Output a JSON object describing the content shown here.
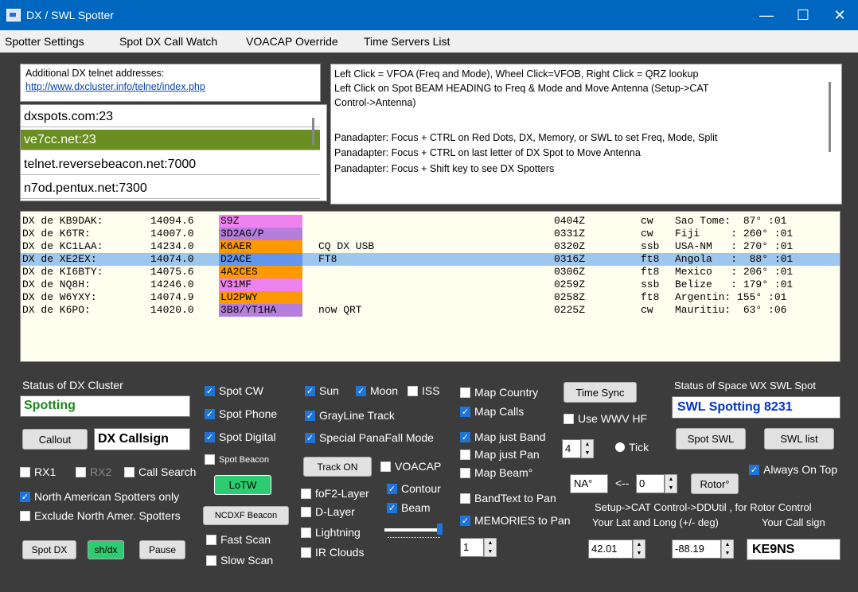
{
  "window": {
    "title": "DX / SWL Spotter"
  },
  "menu": {
    "items": [
      "Spotter Settings",
      "Spot DX Call Watch",
      "VOACAP Override",
      "Time Servers List"
    ]
  },
  "telnet": {
    "header": "Additional DX telnet addresses:",
    "link": "http://www.dxcluster.info/telnet/index.php",
    "items": [
      "dxspots.com:23",
      "ve7cc.net:23",
      "telnet.reversebeacon.net:7000",
      "n7od.pentux.net:7300"
    ],
    "selected_index": 1
  },
  "info": {
    "lines": [
      "Left Click = VFOA (Freq and Mode), Wheel Click=VFOB, Right Click = QRZ lookup",
      "Left Click on Spot BEAM HEADING to Freq & Mode and Move Antenna (Setup->CAT",
      "Control->Antenna)",
      "",
      "Panadapter: Focus + CTRL on Red Dots, DX, Memory, or SWL to set Freq, Mode, Split",
      "Panadapter: Focus + CTRL on last letter of DX Spot to Move Antenna",
      "Panadapter:  Focus + Shift key to see DX Spotters"
    ]
  },
  "spots": [
    {
      "spotter": "DX de KB9DAK:",
      "freq": "14094.6",
      "call": "S9Z",
      "call_color": "#ee82ee",
      "comment": "",
      "time": "0404Z",
      "mode": "cw",
      "country": "Sao Tome:  87° :01"
    },
    {
      "spotter": "DX de K6TR:",
      "freq": "14007.0",
      "call": "3D2AG/P",
      "call_color": "#b57edc",
      "comment": "",
      "time": "0331Z",
      "mode": "cw",
      "country": "Fiji     : 260° :01"
    },
    {
      "spotter": "DX de KC1LAA:",
      "freq": "14234.0",
      "call": "K6AER",
      "call_color": "#ff9900",
      "comment": "CQ DX USB",
      "time": "0320Z",
      "mode": "ssb",
      "country": "USA-NM   : 270° :01"
    },
    {
      "spotter": "DX de XE2EX:",
      "freq": "14074.0",
      "call": "D2ACE",
      "call_color": "#6495ed",
      "comment": "FT8",
      "time": "0316Z",
      "mode": "ft8",
      "country": "Angola   :  88° :01"
    },
    {
      "spotter": "DX de KI6BTY:",
      "freq": "14075.6",
      "call": "4A2CES",
      "call_color": "#ff9900",
      "comment": "",
      "time": "0306Z",
      "mode": "ft8",
      "country": "Mexico   : 206° :01"
    },
    {
      "spotter": "DX de NQ8H:",
      "freq": "14246.0",
      "call": "V31MF",
      "call_color": "#ee82ee",
      "comment": "",
      "time": "0259Z",
      "mode": "ssb",
      "country": "Belize   : 179° :01"
    },
    {
      "spotter": "DX de W6YXY:",
      "freq": "14074.9",
      "call": "LU2PWY",
      "call_color": "#ff9900",
      "comment": "",
      "time": "0258Z",
      "mode": "ft8",
      "country": "Argentin: 155° :01"
    },
    {
      "spotter": "DX de K6PO:",
      "freq": "14020.0",
      "call": "3B8/YT1HA",
      "call_color": "#b57edc",
      "comment": "now QRT",
      "time": "0225Z",
      "mode": "cw",
      "country": "Mauritiu:  63° :06"
    }
  ],
  "selected_spot_index": 3,
  "controls": {
    "status_label": "Status of DX Cluster",
    "status_value": "Spotting",
    "callout_button": "Callout",
    "dx_callsign": "DX Callsign",
    "rx1": "RX1",
    "rx2": "RX2",
    "call_search": "Call Search",
    "na_spotters": "North American Spotters only",
    "exclude_na": "Exclude North Amer. Spotters",
    "spot_dx_button": "Spot DX",
    "shdx_button": "sh/dx",
    "pause_button": "Pause",
    "spot_cw": "Spot CW",
    "spot_phone": "Spot Phone",
    "spot_digital": "Spot Digital",
    "spot_beacon": "Spot Beacon",
    "lotw_button": "LoTW",
    "ncdxf_button": "NCDXF Beacon",
    "fast_scan": "Fast Scan",
    "slow_scan": "Slow Scan",
    "sun": "Sun",
    "moon": "Moon",
    "iss": "ISS",
    "grayline": "GrayLine Track",
    "panafall": "Special PanaFall Mode",
    "track_on_button": "Track ON",
    "voacap": "VOACAP",
    "fof2": "foF2-Layer",
    "contour": "Contour",
    "dlayer": "D-Layer",
    "beam": "Beam",
    "lightning": "Lightning",
    "ir_clouds": "IR Clouds",
    "map_country": "Map Country",
    "map_calls": "Map Calls",
    "map_just_band": "Map just Band",
    "map_just_pan": "Map just Pan",
    "map_beam": "Map Beam°",
    "bandtext": "BandText to Pan",
    "memories": "MEMORIES to Pan",
    "map_spin": "1",
    "time_sync_button": "Time Sync",
    "use_wwv": "Use WWV HF",
    "wwv_spin": "4",
    "tick": "Tick",
    "space_wx_label": "Status of Space WX  SWL Spot",
    "swl_status": "SWL Spotting 8231",
    "spot_swl_button": "Spot SWL",
    "swl_list_button": "SWL list",
    "always_on_top": "Always On Top",
    "rotor_region": "NA°",
    "rotor_arrow": "<--",
    "rotor_spin": "0",
    "rotor_button": "Rotor°",
    "rotor_help": "Setup->CAT Control->DDUtil , for Rotor Control",
    "latlong_label": "Your Lat and Long (+/- deg)",
    "callsign_label": "Your Call sign",
    "lat": "42.01",
    "long": "-88.19",
    "callsign": "KE9NS"
  },
  "colors": {
    "accent": "#0067c0",
    "checkbox": "#1e74d9",
    "lotw": "#2ecc71",
    "status_green": "#1a8a1a",
    "swl_blue": "#0033cc",
    "selected_row": "#9ec7ee",
    "selected_telnet": "#6b8e23"
  }
}
